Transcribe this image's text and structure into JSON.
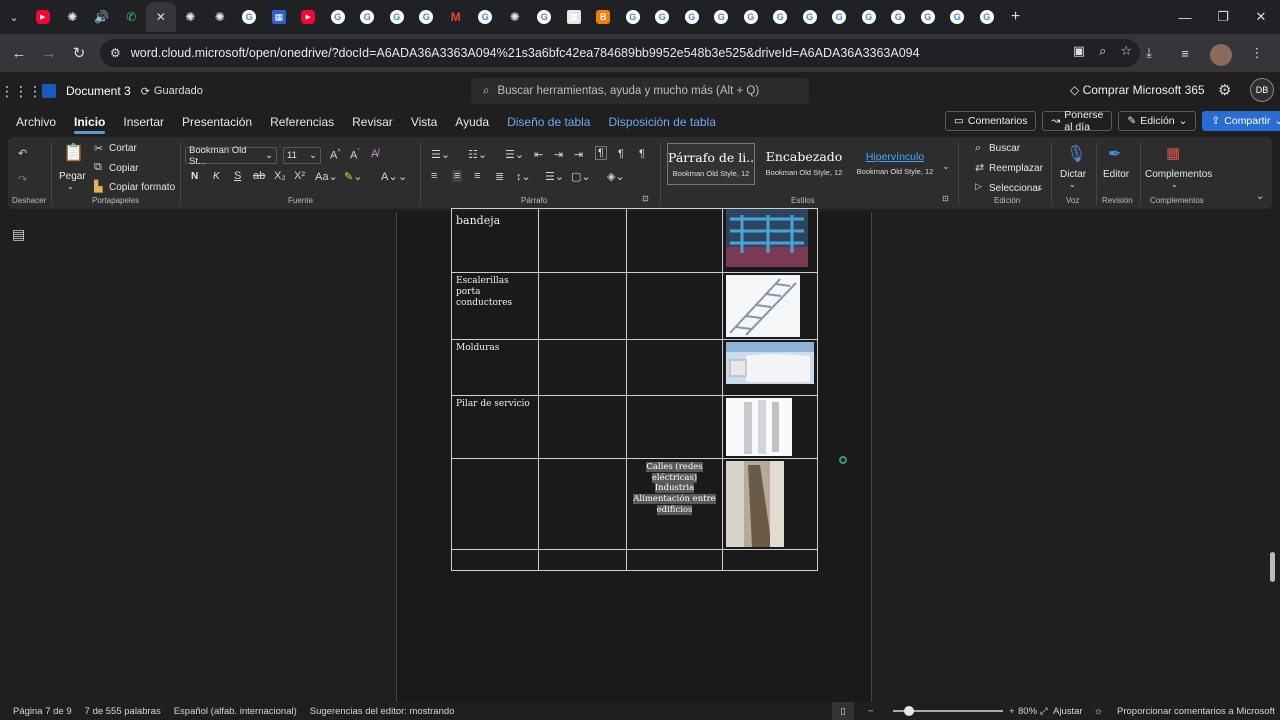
{
  "browser": {
    "tabs": [
      {
        "icon": "youtube-icon",
        "color": "#ff0033"
      },
      {
        "icon": "chatgpt-icon",
        "color": "#e6e6e6"
      },
      {
        "icon": "speaker-icon",
        "color": "#bbb"
      },
      {
        "icon": "whatsapp-icon",
        "color": "#25d366"
      },
      {
        "icon": "close-icon",
        "color": "#ddd"
      },
      {
        "icon": "chatgpt-icon",
        "color": "#e6e6e6"
      },
      {
        "icon": "chatgpt-icon",
        "color": "#e6e6e6"
      },
      {
        "icon": "google-icon",
        "color": "#4285f4"
      },
      {
        "icon": "site-icon",
        "color": "#2a62c9"
      },
      {
        "icon": "youtube-icon",
        "color": "#ff0033"
      },
      {
        "icon": "google-icon",
        "color": "#4285f4"
      },
      {
        "icon": "google-icon",
        "color": "#4285f4"
      },
      {
        "icon": "google-icon",
        "color": "#4285f4"
      },
      {
        "icon": "google-icon",
        "color": "#4285f4"
      },
      {
        "icon": "gmail-icon",
        "color": "#ea4335"
      },
      {
        "icon": "google-icon",
        "color": "#4285f4"
      },
      {
        "icon": "chatgpt-icon",
        "color": "#e6e6e6"
      },
      {
        "icon": "google-icon",
        "color": "#4285f4"
      },
      {
        "icon": "site-icon",
        "color": "#e6e6e6"
      },
      {
        "icon": "blogger-icon",
        "color": "#f57d00"
      },
      {
        "icon": "google-icon",
        "color": "#4285f4"
      },
      {
        "icon": "google-icon",
        "color": "#4285f4"
      },
      {
        "icon": "google-icon",
        "color": "#4285f4"
      },
      {
        "icon": "google-icon",
        "color": "#4285f4"
      },
      {
        "icon": "google-icon",
        "color": "#4285f4"
      },
      {
        "icon": "google-icon",
        "color": "#4285f4"
      },
      {
        "icon": "google-icon",
        "color": "#4285f4"
      },
      {
        "icon": "google-icon",
        "color": "#4285f4"
      },
      {
        "icon": "google-icon",
        "color": "#4285f4"
      },
      {
        "icon": "google-icon",
        "color": "#4285f4"
      },
      {
        "icon": "google-icon",
        "color": "#4285f4"
      },
      {
        "icon": "google-icon",
        "color": "#4285f4"
      },
      {
        "icon": "google-icon",
        "color": "#4285f4"
      }
    ],
    "url": "word.cloud.microsoft/open/onedrive/?docId=A6ADA36A3363A094%21s3a6bfc42ea784689bb9952e548b3e525&driveId=A6ADA36A3363A094"
  },
  "word": {
    "doc_name": "Document 3",
    "saved_status": "Guardado",
    "search_placeholder": "Buscar herramientas, ayuda y mucho más (Alt + Q)",
    "buy_label": "Comprar Microsoft 365",
    "user_initials": "DB"
  },
  "ribbon_tabs": [
    "Archivo",
    "Inicio",
    "Insertar",
    "Presentación",
    "Referencias",
    "Revisar",
    "Vista",
    "Ayuda",
    "Diseño de tabla",
    "Disposición de tabla"
  ],
  "ribbon_right": {
    "comments": "Comentarios",
    "catchup": "Ponerse al día",
    "editing": "Edición",
    "share": "Compartir"
  },
  "ribbon": {
    "undo_group": "Deshacer",
    "paste": "Pegar",
    "cut": "Cortar",
    "copy": "Copiar",
    "format_painter": "Copiar formato",
    "clipboard_group": "Portapapeles",
    "font_name": "Bookman Old St...",
    "font_size": "11",
    "bold": "N",
    "italic": "K",
    "font_group": "Fuente",
    "paragraph_group": "Párrafo",
    "styles": [
      {
        "main": "Párrafo de li...",
        "sub": "Bookman Old Style, 12"
      },
      {
        "main": "Encabezado",
        "sub": "Bookman Old Style, 12"
      },
      {
        "main": "Hipervínculo",
        "sub": "Bookman Old Style, 12"
      }
    ],
    "styles_group": "Estilos",
    "find": "Buscar",
    "replace": "Reemplazar",
    "select": "Seleccionar",
    "editing_group": "Edición",
    "dictate": "Dictar",
    "voice_group": "Voz",
    "editor": "Editor",
    "review_group": "Revisión",
    "addins": "Complementos",
    "addins_group": "Complementos"
  },
  "document": {
    "rows": [
      {
        "label": "bandeja",
        "note": ""
      },
      {
        "label": "Escalerillas porta conductores",
        "note": ""
      },
      {
        "label": "Molduras",
        "note": ""
      },
      {
        "label": "Pilar de servicio",
        "note": ""
      },
      {
        "label": "",
        "note": "Calles (redes eléctricas) Industria Alimentación entre edificios"
      },
      {
        "label": "",
        "note": ""
      }
    ]
  },
  "status": {
    "page": "Página 7 de 9",
    "words": "7 de 555 palabras",
    "language": "Español (alfab. internacional)",
    "editor_suggestions": "Sugerencias del editor: mostrando",
    "zoom": "80%",
    "fit": "Ajustar",
    "feedback": "Proporcionar comentarios a Microsoft"
  }
}
